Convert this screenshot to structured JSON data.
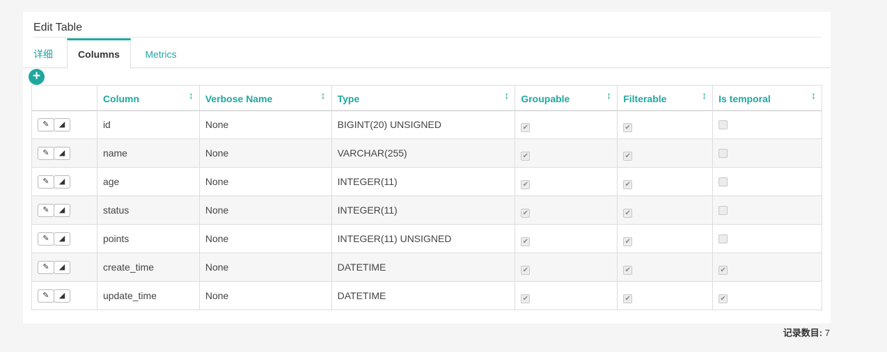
{
  "panel": {
    "title": "Edit Table"
  },
  "tabs": [
    {
      "label": "详细"
    },
    {
      "label": "Columns"
    },
    {
      "label": "Metrics"
    }
  ],
  "add_button_icon": "plus-icon",
  "table": {
    "headers": [
      "Column",
      "Verbose Name",
      "Type",
      "Groupable",
      "Filterable",
      "Is temporal"
    ],
    "rows": [
      {
        "column": "id",
        "verbose_name": "None",
        "type": "BIGINT(20) UNSIGNED",
        "groupable": true,
        "filterable": true,
        "is_temporal": false
      },
      {
        "column": "name",
        "verbose_name": "None",
        "type": "VARCHAR(255)",
        "groupable": true,
        "filterable": true,
        "is_temporal": false
      },
      {
        "column": "age",
        "verbose_name": "None",
        "type": "INTEGER(11)",
        "groupable": true,
        "filterable": true,
        "is_temporal": false
      },
      {
        "column": "status",
        "verbose_name": "None",
        "type": "INTEGER(11)",
        "groupable": true,
        "filterable": true,
        "is_temporal": false
      },
      {
        "column": "points",
        "verbose_name": "None",
        "type": "INTEGER(11) UNSIGNED",
        "groupable": true,
        "filterable": true,
        "is_temporal": false
      },
      {
        "column": "create_time",
        "verbose_name": "None",
        "type": "DATETIME",
        "groupable": true,
        "filterable": true,
        "is_temporal": true
      },
      {
        "column": "update_time",
        "verbose_name": "None",
        "type": "DATETIME",
        "groupable": true,
        "filterable": true,
        "is_temporal": true
      }
    ]
  },
  "footer": {
    "count_label": "记录数目:",
    "count_value": "7"
  },
  "colors": {
    "accent": "#20a7a0",
    "border": "#dddddd"
  }
}
